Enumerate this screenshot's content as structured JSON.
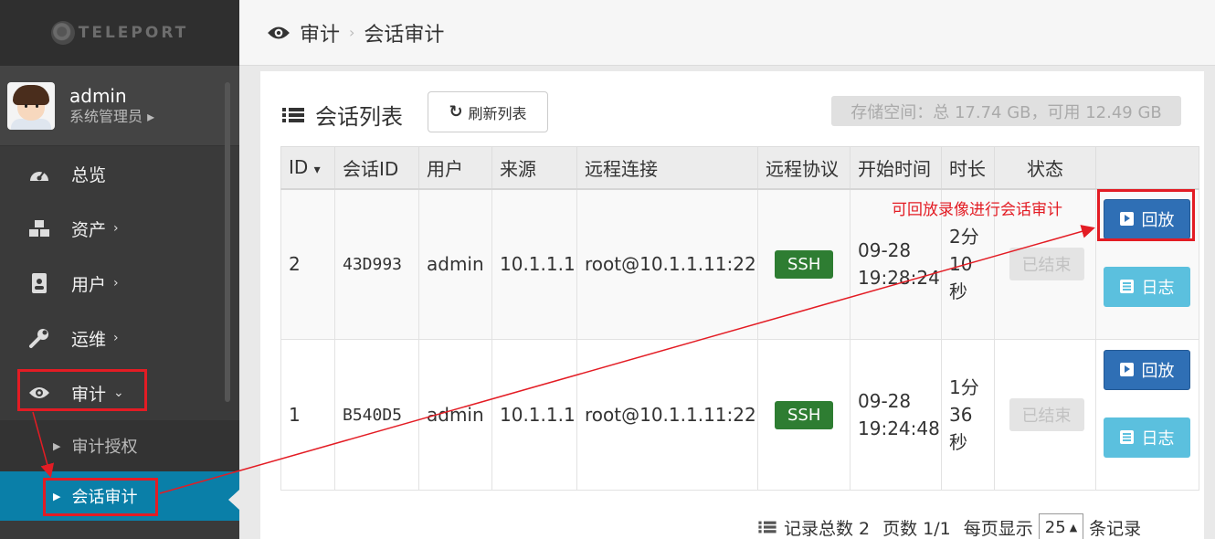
{
  "app": {
    "logo_text": "TELEPORT"
  },
  "user": {
    "name": "admin",
    "role": "系统管理员 ▸"
  },
  "nav": [
    {
      "id": "overview",
      "label": "总览",
      "icon": "dashboard-icon",
      "chevron": ""
    },
    {
      "id": "assets",
      "label": "资产",
      "icon": "cubes-icon",
      "chevron": "›"
    },
    {
      "id": "users",
      "label": "用户",
      "icon": "address-card-icon",
      "chevron": "›"
    },
    {
      "id": "ops",
      "label": "运维",
      "icon": "wrench-icon",
      "chevron": "›"
    },
    {
      "id": "audit",
      "label": "审计",
      "icon": "eye-icon",
      "chevron": "⌄"
    }
  ],
  "subnav": [
    {
      "label": "审计授权",
      "active": false
    },
    {
      "label": "会话审计",
      "active": true
    }
  ],
  "breadcrumb": {
    "section": "审计",
    "separator": "›",
    "page": "会话审计"
  },
  "panel": {
    "title": "会话列表",
    "refresh_label": "刷新列表",
    "storage": "存储空间：总 17.74 GB，可用 12.49 GB"
  },
  "table": {
    "headers": [
      "ID",
      "会话ID",
      "用户",
      "来源",
      "远程连接",
      "远程协议",
      "开始时间",
      "时长",
      "状态",
      ""
    ],
    "sort_indicator": "▾",
    "rows": [
      {
        "id": "2",
        "session_id": "43D993",
        "user": "admin",
        "source": "10.1.1.1",
        "remote": "root@10.1.1.11:22",
        "protocol": "SSH",
        "start_date": "09-28",
        "start_time": "19:28:24",
        "duration_l1": "2分",
        "duration_l2": "10",
        "duration_l3": "秒",
        "status": "已结束",
        "play_label": "回放",
        "log_label": "日志"
      },
      {
        "id": "1",
        "session_id": "B540D5",
        "user": "admin",
        "source": "10.1.1.1",
        "remote": "root@10.1.1.11:22",
        "protocol": "SSH",
        "start_date": "09-28",
        "start_time": "19:24:48",
        "duration_l1": "1分",
        "duration_l2": "36",
        "duration_l3": "秒",
        "status": "已结束",
        "play_label": "回放",
        "log_label": "日志"
      }
    ]
  },
  "footer": {
    "total_label": "记录总数 2",
    "page_label": "页数 1/1",
    "per_page_label": "每页显示",
    "per_page_value": "25",
    "records_suffix": "条记录"
  },
  "annotation": {
    "text": "可回放录像进行会话审计",
    "color": "#e31c24"
  },
  "colors": {
    "sidebar_bg": "#3a3a3a",
    "active_sub": "#0a7fa8",
    "ssh_badge": "#2e7d32",
    "play_button": "#2f6fb5",
    "log_button": "#5bc0de"
  }
}
